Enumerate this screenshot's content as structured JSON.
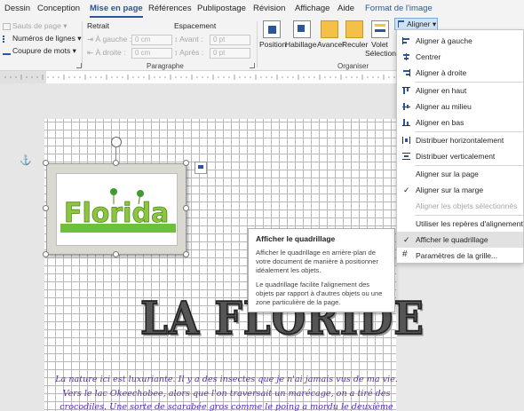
{
  "tabs": [
    "Dessin",
    "Conception",
    "Mise en page",
    "Références",
    "Publipostage",
    "Révision",
    "Affichage",
    "Aide",
    "Format de l'image"
  ],
  "ribbon": {
    "sauts_de_page": "Sauts de page",
    "numeros_de_lignes": "Numéros de lignes",
    "coupure_de_mots": "Coupure de mots",
    "retrait_label": "Retrait",
    "a_gauche_label": "À gauche :",
    "a_gauche_value": "0 cm",
    "a_droite_label": "À droite :",
    "a_droite_value": "0 cm",
    "espacement_label": "Espacement",
    "avant_label": "Avant :",
    "avant_value": "0 pt",
    "apres_label": "Après :",
    "apres_value": "0 pt",
    "paragraphe_label": "Paragraphe",
    "organiser_label": "Organiser",
    "position": "Position",
    "habillage": "Habillage",
    "avancer": "Avancer",
    "reculer": "Reculer",
    "volet_line1": "Volet",
    "volet_line2": "Sélection",
    "aligner_button": "Aligner"
  },
  "menu": {
    "items": [
      "Aligner à gauche",
      "Centrer",
      "Aligner à droite",
      "Aligner en haut",
      "Aligner au milieu",
      "Aligner en bas",
      "Distribuer horizontalement",
      "Distribuer verticalement",
      "Aligner sur la page",
      "Aligner sur la marge",
      "Aligner les objets sélectionnés",
      "Utiliser les repères d'alignement",
      "Afficher le quadrillage",
      "Paramètres de la grille..."
    ]
  },
  "tooltip": {
    "title": "Afficher le quadrillage",
    "paragraph1": "Afficher le quadrillage en arrière-plan de votre document de manière à positionner idéalement les objets.",
    "paragraph2": "Le quadrillage facilite l'alignement des objets par rapport à d'autres objets ou une zone particulière de la page."
  },
  "document": {
    "image_caption": "Florida",
    "big_title": "LA FLORIDE",
    "body_line1": "La nature ici est luxuriante. Il y a des insectes que je n'ai jamais vus de ma vie.",
    "body_line2": "Vers le lac Okeechobee, alors que l'on traversait un marécage, on a tiré des",
    "body_line3": "crocodiles. Une sorte de scarabée gros comme le poing a mordu le deuxième"
  },
  "colors": {
    "accent": "#2b579a",
    "body_text": "#5b2bbd",
    "menu_highlight": "#e1e1e1"
  }
}
